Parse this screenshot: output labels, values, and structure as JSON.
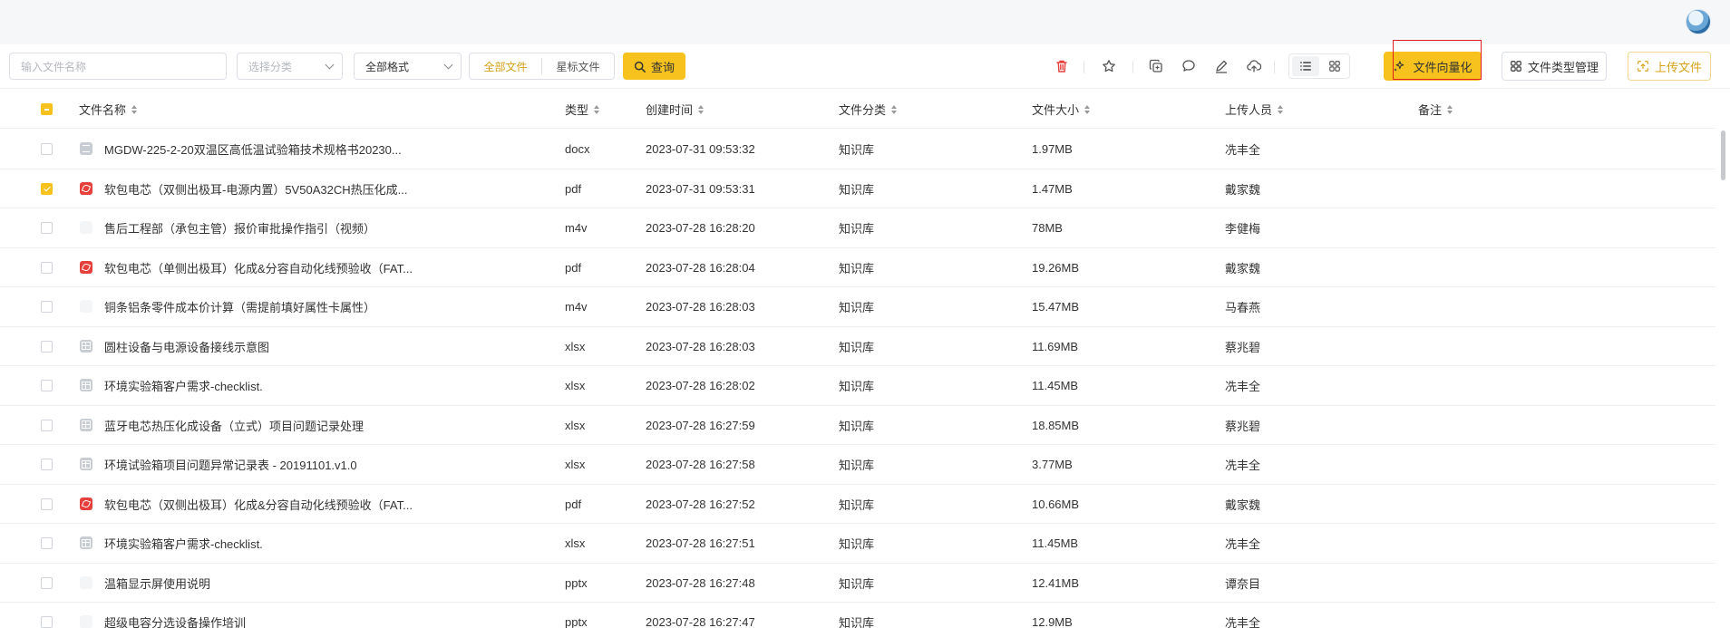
{
  "toolbar": {
    "filename_placeholder": "输入文件名称",
    "category_placeholder": "选择分类",
    "format_value": "全部格式",
    "segment_all": "全部文件",
    "segment_starred": "星标文件",
    "query_label": "查询",
    "vectorize_label": "文件向量化",
    "type_manage_label": "文件类型管理",
    "upload_label": "上传文件"
  },
  "colors": {
    "accent": "#f7c21d",
    "accent_text": "#d4a017",
    "danger": "#e5403b",
    "highlight_outline": "#e02020"
  },
  "table": {
    "headers": {
      "name": "文件名称",
      "type": "类型",
      "created": "创建时间",
      "category": "文件分类",
      "size": "文件大小",
      "uploader": "上传人员",
      "note": "备注"
    },
    "rows": [
      {
        "checked": false,
        "icon": "doc",
        "name": "MGDW-225-2-20双温区高低温试验箱技术规格书20230...",
        "type": "docx",
        "created": "2023-07-31 09:53:32",
        "category": "知识库",
        "size": "1.97MB",
        "uploader": "冼丰全",
        "note": ""
      },
      {
        "checked": true,
        "icon": "pdf",
        "name": "软包电芯（双侧出极耳-电源内置）5V50A32CH热压化成...",
        "type": "pdf",
        "created": "2023-07-31 09:53:31",
        "category": "知识库",
        "size": "1.47MB",
        "uploader": "戴家魏",
        "note": ""
      },
      {
        "checked": false,
        "icon": "blank",
        "name": "售后工程部（承包主管）报价审批操作指引（视频）",
        "type": "m4v",
        "created": "2023-07-28 16:28:20",
        "category": "知识库",
        "size": "78MB",
        "uploader": "李健梅",
        "note": ""
      },
      {
        "checked": false,
        "icon": "pdf",
        "name": "软包电芯（单侧出极耳）化成&分容自动化线预验收（FAT...",
        "type": "pdf",
        "created": "2023-07-28 16:28:04",
        "category": "知识库",
        "size": "19.26MB",
        "uploader": "戴家魏",
        "note": ""
      },
      {
        "checked": false,
        "icon": "blank",
        "name": "铜条铝条零件成本价计算（需提前填好属性卡属性）",
        "type": "m4v",
        "created": "2023-07-28 16:28:03",
        "category": "知识库",
        "size": "15.47MB",
        "uploader": "马春燕",
        "note": ""
      },
      {
        "checked": false,
        "icon": "sheet",
        "name": "圆柱设备与电源设备接线示意图",
        "type": "xlsx",
        "created": "2023-07-28 16:28:03",
        "category": "知识库",
        "size": "11.69MB",
        "uploader": "蔡兆碧",
        "note": ""
      },
      {
        "checked": false,
        "icon": "sheet",
        "name": "环境实验箱客户需求-checklist.",
        "type": "xlsx",
        "created": "2023-07-28 16:28:02",
        "category": "知识库",
        "size": "11.45MB",
        "uploader": "冼丰全",
        "note": ""
      },
      {
        "checked": false,
        "icon": "sheet",
        "name": "蓝牙电芯热压化成设备（立式）项目问题记录处理",
        "type": "xlsx",
        "created": "2023-07-28 16:27:59",
        "category": "知识库",
        "size": "18.85MB",
        "uploader": "蔡兆碧",
        "note": ""
      },
      {
        "checked": false,
        "icon": "sheet",
        "name": "环境试验箱项目问题异常记录表 - 20191101.v1.0",
        "type": "xlsx",
        "created": "2023-07-28 16:27:58",
        "category": "知识库",
        "size": "3.77MB",
        "uploader": "冼丰全",
        "note": ""
      },
      {
        "checked": false,
        "icon": "pdf",
        "name": "软包电芯（双侧出极耳）化成&分容自动化线预验收（FAT...",
        "type": "pdf",
        "created": "2023-07-28 16:27:52",
        "category": "知识库",
        "size": "10.66MB",
        "uploader": "戴家魏",
        "note": ""
      },
      {
        "checked": false,
        "icon": "sheet",
        "name": "环境实验箱客户需求-checklist.",
        "type": "xlsx",
        "created": "2023-07-28 16:27:51",
        "category": "知识库",
        "size": "11.45MB",
        "uploader": "冼丰全",
        "note": ""
      },
      {
        "checked": false,
        "icon": "blank",
        "name": "温箱显示屏使用说明",
        "type": "pptx",
        "created": "2023-07-28 16:27:48",
        "category": "知识库",
        "size": "12.41MB",
        "uploader": "谭奈目",
        "note": ""
      },
      {
        "checked": false,
        "icon": "blank",
        "name": "超级电容分选设备操作培训",
        "type": "pptx",
        "created": "2023-07-28 16:27:47",
        "category": "知识库",
        "size": "12.9MB",
        "uploader": "冼丰全",
        "note": ""
      }
    ]
  }
}
